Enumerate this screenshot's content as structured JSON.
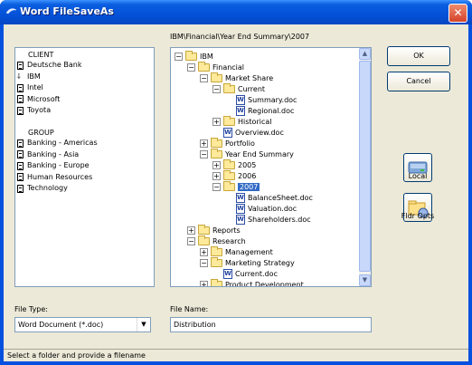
{
  "window": {
    "title": "Word FileSaveAs",
    "close_glyph": "✕"
  },
  "left_panel": {
    "groups": [
      {
        "heading": "CLIENT",
        "items": [
          {
            "label": "Deutsche Bank",
            "icon": "document-icon"
          },
          {
            "label": "IBM",
            "icon": "pin-icon"
          },
          {
            "label": "Intel",
            "icon": "document-icon"
          },
          {
            "label": "Microsoft",
            "icon": "document-icon"
          },
          {
            "label": "Toyota",
            "icon": "document-icon"
          }
        ]
      },
      {
        "heading": "GROUP",
        "items": [
          {
            "label": "Banking - Americas",
            "icon": "document-icon"
          },
          {
            "label": "Banking - Asia",
            "icon": "document-icon"
          },
          {
            "label": "Banking - Europe",
            "icon": "document-icon"
          },
          {
            "label": "Human Resources",
            "icon": "document-icon"
          },
          {
            "label": "Technology",
            "icon": "document-icon"
          }
        ]
      }
    ]
  },
  "path": "IBM\\Financial\\Year End Summary\\2007",
  "tree": [
    {
      "label": "IBM",
      "type": "folder",
      "depth": 0,
      "expander": "−"
    },
    {
      "label": "Financial",
      "type": "folder",
      "depth": 1,
      "expander": "−"
    },
    {
      "label": "Market Share",
      "type": "folder",
      "depth": 2,
      "expander": "−"
    },
    {
      "label": "Current",
      "type": "folder",
      "depth": 3,
      "expander": "−"
    },
    {
      "label": "Summary.doc",
      "type": "doc",
      "depth": 4,
      "expander": ""
    },
    {
      "label": "Regional.doc",
      "type": "doc",
      "depth": 4,
      "expander": ""
    },
    {
      "label": "Historical",
      "type": "folder",
      "depth": 3,
      "expander": "+"
    },
    {
      "label": "Overview.doc",
      "type": "doc",
      "depth": 3,
      "expander": ""
    },
    {
      "label": "Portfolio",
      "type": "folder",
      "depth": 2,
      "expander": "+"
    },
    {
      "label": "Year End Summary",
      "type": "folder",
      "depth": 2,
      "expander": "−"
    },
    {
      "label": "2005",
      "type": "folder",
      "depth": 3,
      "expander": "+"
    },
    {
      "label": "2006",
      "type": "folder",
      "depth": 3,
      "expander": "+"
    },
    {
      "label": "2007",
      "type": "folder-open",
      "depth": 3,
      "expander": "−",
      "selected": true
    },
    {
      "label": "BalanceSheet.doc",
      "type": "doc",
      "depth": 4,
      "expander": ""
    },
    {
      "label": "Valuation.doc",
      "type": "doc",
      "depth": 4,
      "expander": ""
    },
    {
      "label": "Shareholders.doc",
      "type": "doc",
      "depth": 4,
      "expander": ""
    },
    {
      "label": "Reports",
      "type": "folder",
      "depth": 1,
      "expander": "+"
    },
    {
      "label": "Research",
      "type": "folder",
      "depth": 1,
      "expander": "−"
    },
    {
      "label": "Management",
      "type": "folder",
      "depth": 2,
      "expander": "+"
    },
    {
      "label": "Marketing Strategy",
      "type": "folder",
      "depth": 2,
      "expander": "−"
    },
    {
      "label": "Current.doc",
      "type": "doc",
      "depth": 3,
      "expander": ""
    },
    {
      "label": "Product Development",
      "type": "folder",
      "depth": 2,
      "expander": "+"
    }
  ],
  "buttons": {
    "ok": "OK",
    "cancel": "Cancel",
    "local": "Local",
    "fldr_opts": "Fldr Opts"
  },
  "file_type": {
    "label": "File Type:",
    "value": "Word Document (*.doc)"
  },
  "file_name": {
    "label": "File Name:",
    "value": "Distribution"
  },
  "status": "Select a folder and provide a filename",
  "colors": {
    "title_bar": "#0351d8",
    "selection": "#316ac5",
    "dialog_bg": "#ece9d8"
  }
}
